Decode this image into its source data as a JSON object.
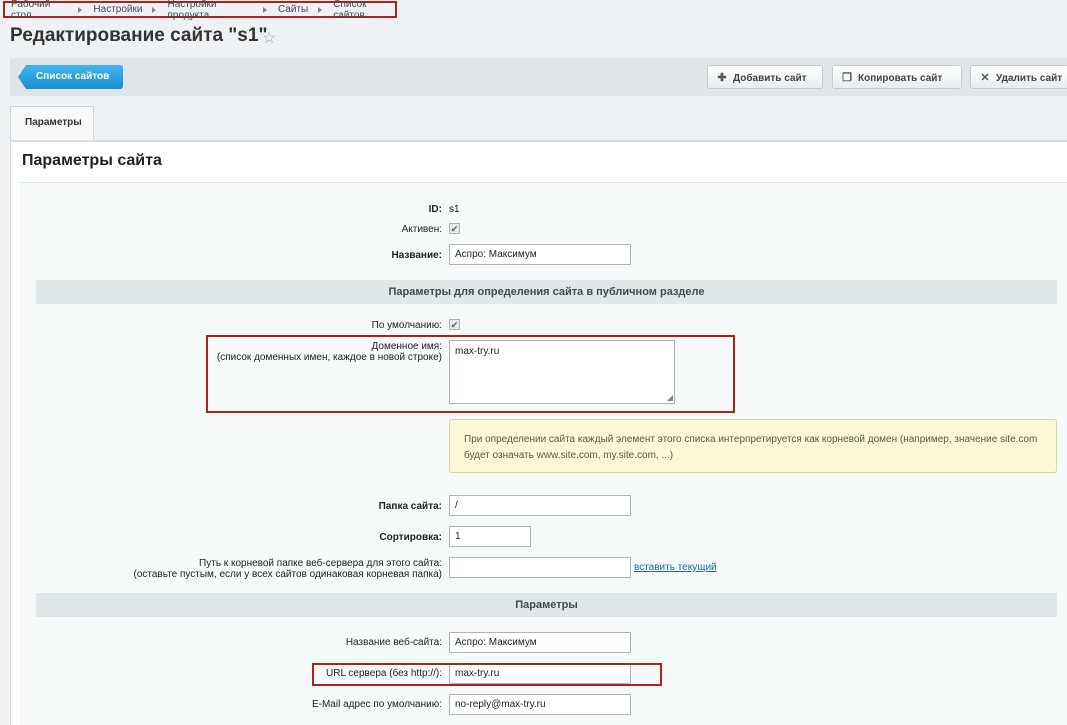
{
  "breadcrumb": [
    "Рабочий стол",
    "Настройки",
    "Настройки продукта",
    "Сайты",
    "Список сайтов"
  ],
  "page": {
    "title": "Редактирование сайта \"s1\""
  },
  "toolbar": {
    "back_label": "Список сайтов",
    "add_label": "Добавить сайт",
    "copy_label": "Копировать сайт",
    "delete_label": "Удалить сайт"
  },
  "tabs": [
    {
      "label": "Параметры"
    }
  ],
  "section_title": "Параметры сайта",
  "form": {
    "id_label": "ID:",
    "id_value": "s1",
    "active_label": "Активен:",
    "active_checked": true,
    "name_label": "Название:",
    "name_value": "Аспро: Максимум",
    "public_band": "Параметры для определения сайта в публичном разделе",
    "default_label": "По умолчанию:",
    "default_checked": true,
    "domain_label": "Доменное имя:",
    "domain_sublabel": "(список доменных имен, каждое в новой строке)",
    "domain_value": "max-try.ru",
    "hint": "При определении сайта каждый элемент этого списка интерпретируется как корневой домен (например, значение site.com будет означать www.site.com, my.site.com, ...)",
    "folder_label": "Папка сайта:",
    "folder_value": "/",
    "sort_label": "Сортировка:",
    "sort_value": "1",
    "docroot_label": "Путь к корневой папке веб-сервера для этого сайта:",
    "docroot_sublabel": "(оставьте пустым, если у всех сайтов одинаковая корневая папка)",
    "docroot_value": "",
    "docroot_link": "вставить текущий",
    "params_band": "Параметры",
    "site_name_label": "Название веб-сайта:",
    "site_name_value": "Аспро: Максимум",
    "server_url_label": "URL сервера (без http://):",
    "server_url_value": "max-try.ru",
    "email_label": "E-Mail адрес по умолчанию:",
    "email_value": "no-reply@max-try.ru"
  },
  "colors": {
    "highlight": "#b31e1e",
    "primary_button": "#1b8fd1",
    "link": "#2067b0",
    "hint_bg": "#fbf8d6"
  },
  "icons": {
    "star": "star-icon",
    "add": "plus-icon",
    "copy": "copy-icon",
    "delete": "close-icon",
    "check": "check-icon"
  }
}
